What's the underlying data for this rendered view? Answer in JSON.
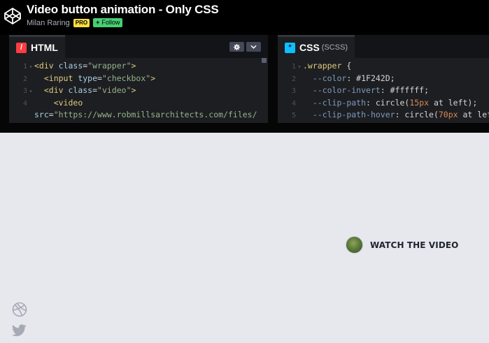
{
  "header": {
    "title": "Video button animation - Only CSS",
    "author": "Milan Raring",
    "pro_badge": "PRO",
    "follow_icon": "+",
    "follow_label": "Follow"
  },
  "html_pane": {
    "tab_icon": "/",
    "tab_label": "HTML",
    "settings_icon": "gear-icon",
    "collapse_icon": "chevron-down-icon",
    "line_numbers": [
      "1",
      "2",
      "3",
      "4",
      ""
    ],
    "code": {
      "l1_open": "<div ",
      "l1_attr": "class",
      "l1_eq": "=",
      "l1_val": "\"wrapper\"",
      "l1_close": ">",
      "l2_open": "<input ",
      "l2_attr": "type",
      "l2_eq": "=",
      "l2_val": "\"checkbox\"",
      "l2_close": ">",
      "l3_open": "<div ",
      "l3_attr": "class",
      "l3_eq": "=",
      "l3_val": "\"video\"",
      "l3_close": ">",
      "l4_tag": "<video",
      "l5_attr": "src",
      "l5_eq": "=",
      "l5_val": "\"https://www.robmillsarchitects.com/files/"
    }
  },
  "css_pane": {
    "tab_icon": "*",
    "tab_label": "CSS",
    "tab_sub": "(SCSS)",
    "line_numbers": [
      "1",
      "2",
      "3",
      "4",
      "5"
    ],
    "code": {
      "l1_sel": ".wrapper",
      "l1_brace": " {",
      "l2_prop": "--color",
      "l2_val": ": #1F242D;",
      "l3_prop": "--color-invert",
      "l3_val": ": #ffffff;",
      "l4_prop": "--clip-path",
      "l4_fn": ": circle(",
      "l4_num": "15px",
      "l4_rest": " at left);",
      "l5_prop": "--clip-path-hover",
      "l5_fn": ": circle(",
      "l5_num": "70px",
      "l5_rest": " at left);"
    }
  },
  "preview": {
    "watch_label": "WATCH THE VIDEO",
    "accent_color": "#1F242D",
    "social_icons": [
      "dribbble-icon",
      "twitter-icon"
    ]
  }
}
